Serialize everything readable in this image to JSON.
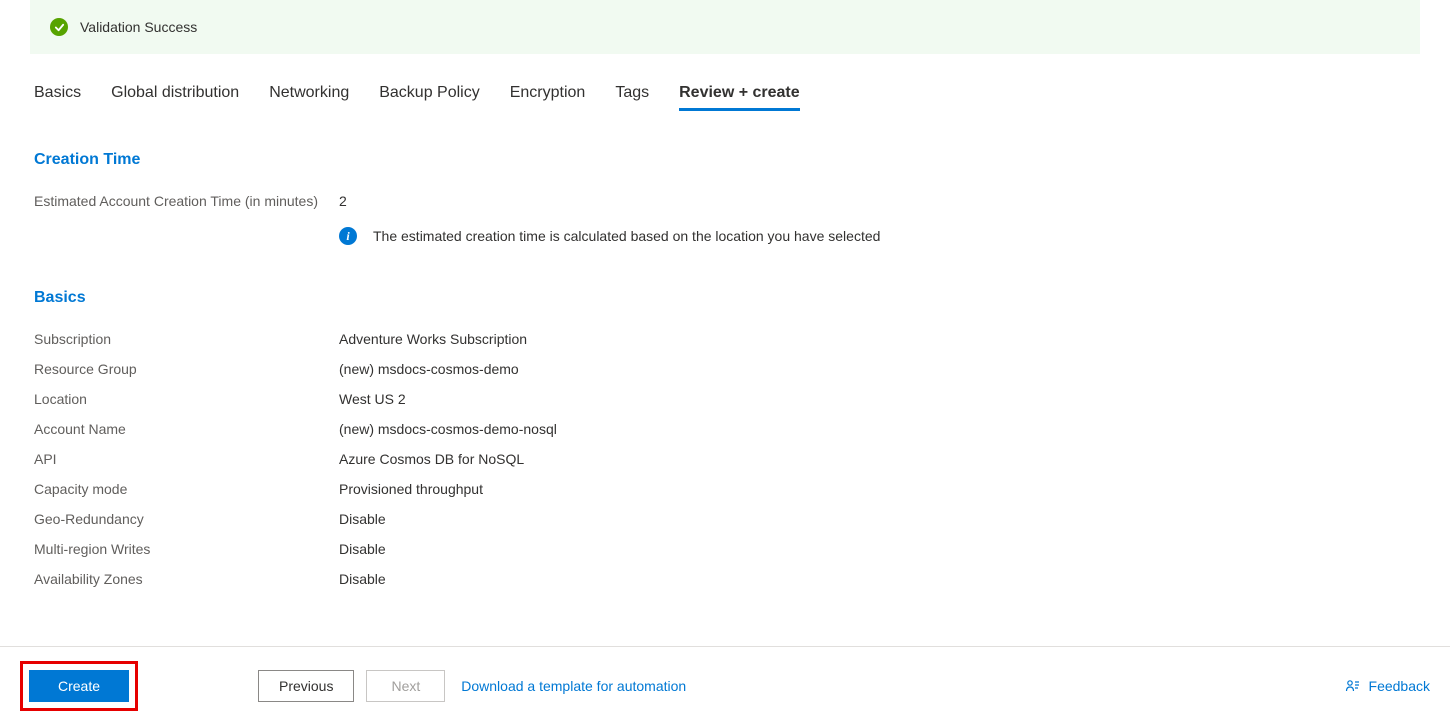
{
  "banner": {
    "message": "Validation Success"
  },
  "tabs": [
    {
      "label": "Basics",
      "active": false
    },
    {
      "label": "Global distribution",
      "active": false
    },
    {
      "label": "Networking",
      "active": false
    },
    {
      "label": "Backup Policy",
      "active": false
    },
    {
      "label": "Encryption",
      "active": false
    },
    {
      "label": "Tags",
      "active": false
    },
    {
      "label": "Review + create",
      "active": true
    }
  ],
  "sections": {
    "creation_time": {
      "heading": "Creation Time",
      "estimate_label": "Estimated Account Creation Time (in minutes)",
      "estimate_value": "2",
      "info_text": "The estimated creation time is calculated based on the location you have selected"
    },
    "basics": {
      "heading": "Basics",
      "rows": [
        {
          "label": "Subscription",
          "value": "Adventure Works Subscription"
        },
        {
          "label": "Resource Group",
          "value": "(new) msdocs-cosmos-demo"
        },
        {
          "label": "Location",
          "value": "West US 2"
        },
        {
          "label": "Account Name",
          "value": "(new) msdocs-cosmos-demo-nosql"
        },
        {
          "label": "API",
          "value": "Azure Cosmos DB for NoSQL"
        },
        {
          "label": "Capacity mode",
          "value": "Provisioned throughput"
        },
        {
          "label": "Geo-Redundancy",
          "value": "Disable"
        },
        {
          "label": "Multi-region Writes",
          "value": "Disable"
        },
        {
          "label": "Availability Zones",
          "value": "Disable"
        }
      ]
    }
  },
  "footer": {
    "create": "Create",
    "previous": "Previous",
    "next": "Next",
    "download_link": "Download a template for automation",
    "feedback": "Feedback"
  }
}
